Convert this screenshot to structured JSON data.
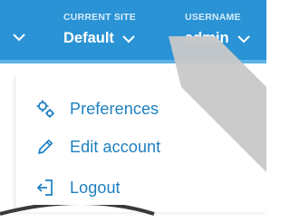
{
  "header": {
    "site": {
      "caption": "CURRENT SITE",
      "value": "Default"
    },
    "user": {
      "caption": "USERNAME",
      "value": "admin"
    }
  },
  "menu": {
    "items": [
      {
        "label": "Preferences",
        "icon": "gears-icon"
      },
      {
        "label": "Edit account",
        "icon": "pencil-icon"
      },
      {
        "label": "Logout",
        "icon": "logout-icon"
      }
    ]
  },
  "colors": {
    "header_bg": "#2a93d5",
    "accent": "#5bb4e8",
    "link": "#1d7fc0",
    "overlay": "#c8c8c8"
  }
}
